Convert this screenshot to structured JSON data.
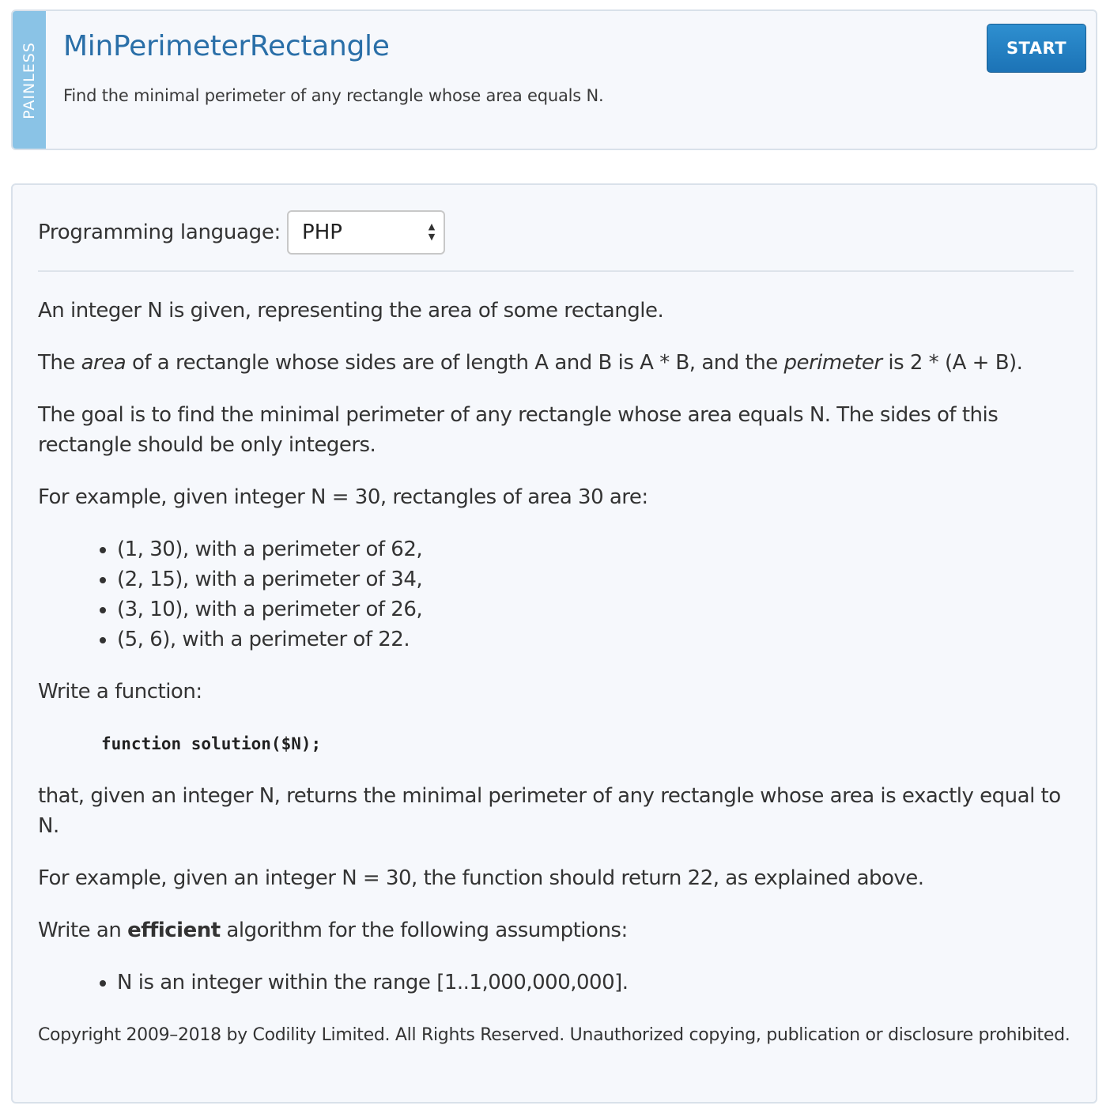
{
  "task": {
    "difficulty": "PAINLESS",
    "title": "MinPerimeterRectangle",
    "subtitle": "Find the minimal perimeter of any rectangle whose area equals N.",
    "start_label": "START"
  },
  "language": {
    "label": "Programming language:",
    "selected": "PHP"
  },
  "description": {
    "intro": "An integer N is given, representing the area of some rectangle.",
    "area_def": {
      "part1": "The ",
      "area_word": "area",
      "part2": " of a rectangle whose sides are of length A and B is A * B, and the ",
      "perimeter_word": "perimeter",
      "part3": " is 2 * (A + B)."
    },
    "goal": "The goal is to find the minimal perimeter of any rectangle whose area equals N. The sides of this rectangle should be only integers.",
    "example_intro": "For example, given integer N = 30, rectangles of area 30 are:",
    "examples": [
      "(1, 30), with a perimeter of 62,",
      "(2, 15), with a perimeter of 34,",
      "(3, 10), with a perimeter of 26,",
      "(5, 6), with a perimeter of 22."
    ],
    "write_function": "Write a function:",
    "signature": "function solution($N);",
    "returns": "that, given an integer N, returns the minimal perimeter of any rectangle whose area is exactly equal to N.",
    "example_result": "For example, given an integer N = 30, the function should return 22, as explained above.",
    "efficient": {
      "part1": "Write an ",
      "bold_word": "efficient",
      "part2": " algorithm for the following assumptions:"
    },
    "assumptions": [
      "N is an integer within the range [1..1,000,000,000]."
    ],
    "copyright": "Copyright 2009–2018 by Codility Limited. All Rights Reserved. Unauthorized copying, publication or disclosure prohibited."
  },
  "colors": {
    "accent": "#2a6fa8",
    "difficulty_strip": "#8ac3e6",
    "start_button": "#1c73b6",
    "card_background": "#f6f8fc"
  },
  "icons": {
    "select_arrows": "up-down-arrows-icon"
  }
}
